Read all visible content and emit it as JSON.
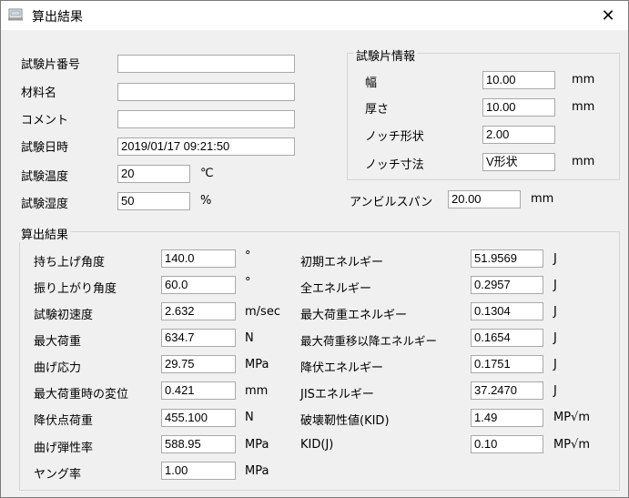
{
  "window": {
    "title": "算出結果",
    "close_symbol": "✕"
  },
  "top_fields": [
    {
      "key": "specimen_no",
      "label": "試験片番号",
      "value": ""
    },
    {
      "key": "material",
      "label": "材料名",
      "value": ""
    },
    {
      "key": "comment",
      "label": "コメント",
      "value": ""
    },
    {
      "key": "date",
      "label": "試験日時",
      "value": "2019/01/17 09:21:50"
    },
    {
      "key": "temperature",
      "label": "試験温度",
      "value": "20",
      "unit": "℃"
    },
    {
      "key": "humidity",
      "label": "試験湿度",
      "value": "50",
      "unit": "%"
    }
  ],
  "specimen_info": {
    "title": "試験片情報",
    "rows": [
      {
        "key": "width",
        "label": "幅",
        "value": "10.00",
        "unit": "mm"
      },
      {
        "key": "thickness",
        "label": "厚さ",
        "value": "10.00",
        "unit": "mm"
      },
      {
        "key": "notch_shape",
        "label": "ノッチ形状",
        "value": "2.00",
        "unit": ""
      },
      {
        "key": "notch_size",
        "label": "ノッチ寸法",
        "value": "V形状",
        "unit": "mm"
      }
    ]
  },
  "anvil_span": {
    "label": "アンビルスパン",
    "value": "20.00",
    "unit": "mm"
  },
  "results": {
    "title": "算出結果",
    "left": [
      {
        "key": "lift_angle",
        "label": "持ち上げ角度",
        "value": "140.0",
        "unit": "°"
      },
      {
        "key": "swing_angle",
        "label": "振り上がり角度",
        "value": "60.0",
        "unit": "°"
      },
      {
        "key": "initial_velocity",
        "label": "試験初速度",
        "value": "2.632",
        "unit": "m/sec"
      },
      {
        "key": "max_load",
        "label": "最大荷重",
        "value": "634.7",
        "unit": "N"
      },
      {
        "key": "bending_stress",
        "label": "曲げ応力",
        "value": "29.75",
        "unit": "MPa"
      },
      {
        "key": "disp_at_max_load",
        "label": "最大荷重時の変位",
        "value": "0.421",
        "unit": "mm"
      },
      {
        "key": "yield_load",
        "label": "降伏点荷重",
        "value": "455.100",
        "unit": "N"
      },
      {
        "key": "flexural_modulus",
        "label": "曲げ弾性率",
        "value": "588.95",
        "unit": "MPa"
      },
      {
        "key": "youngs_modulus",
        "label": "ヤング率",
        "value": "1.00",
        "unit": "MPa"
      }
    ],
    "right": [
      {
        "key": "initial_energy",
        "label": "初期エネルギー",
        "value": "51.9569",
        "unit": "J"
      },
      {
        "key": "total_energy",
        "label": "全エネルギー",
        "value": "0.2957",
        "unit": "J"
      },
      {
        "key": "max_load_energy",
        "label": "最大荷重エネルギー",
        "value": "0.1304",
        "unit": "J"
      },
      {
        "key": "post_max_energy",
        "label": "最大荷重移以降エネルギー",
        "value": "0.1654",
        "unit": "J"
      },
      {
        "key": "yield_energy",
        "label": "降伏エネルギー",
        "value": "0.1751",
        "unit": "J"
      },
      {
        "key": "jis_energy",
        "label": "JISエネルギー",
        "value": "37.2470",
        "unit": "J"
      },
      {
        "key": "fracture_toughness",
        "label": "破壊靭性値(KID)",
        "value": "1.49",
        "unit": "MP√m"
      },
      {
        "key": "kid_j",
        "label": "KID(J)",
        "value": "0.10",
        "unit": "MP√m"
      }
    ]
  }
}
